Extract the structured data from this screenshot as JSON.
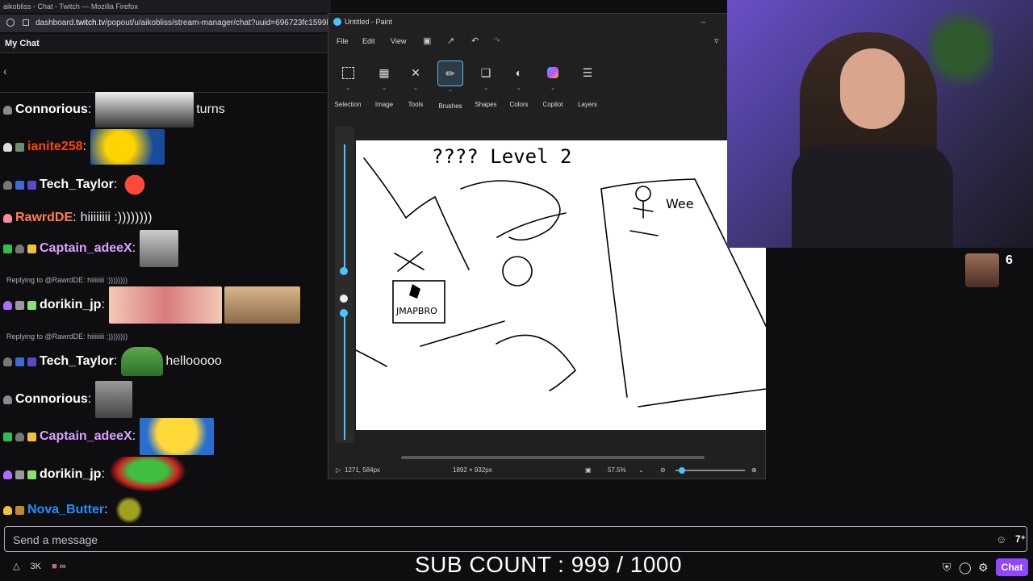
{
  "browser": {
    "title": "aikobliss - Chat - Twitch — Mozilla Firefox",
    "url_prefix": "dashboard.",
    "url_domain": "twitch.tv",
    "url_rest": "/popout/u/aikobliss/stream-manager/chat?uuid=696723fc1599b9429"
  },
  "chat": {
    "header": "My Chat",
    "messages": [
      {
        "user": "Connorious",
        "color": "#ffffff",
        "text": "turns"
      },
      {
        "user": "ianite258",
        "color": "#ff4500",
        "text": ""
      },
      {
        "user": "Tech_Taylor",
        "color": "#ffffff",
        "text": ""
      },
      {
        "user": "RawrdDE",
        "color": "#ff7f50",
        "text": "hiiiiiiii :))))))))"
      },
      {
        "user": "Captain_adeeX",
        "color": "#d9a3ff",
        "text": ""
      },
      {
        "user": "dorikin_jp",
        "color": "#ffffff",
        "text": "",
        "reply": "Replying to @RawrdDE: hiiiiiiii :))))))))"
      },
      {
        "user": "Tech_Taylor",
        "color": "#ffffff",
        "text": "hellooooo",
        "reply": "Replying to @RawrdDE: hiiiiiiii :))))))))"
      },
      {
        "user": "Connorious",
        "color": "#ffffff",
        "text": ""
      },
      {
        "user": "Captain_adeeX",
        "color": "#d9a3ff",
        "text": ""
      },
      {
        "user": "dorikin_jp",
        "color": "#ffffff",
        "text": ""
      },
      {
        "user": "Nova_Butter",
        "color": "#1e90ff",
        "text": ""
      }
    ],
    "input_placeholder": "Send a message",
    "channel_points": "3K",
    "chat_button": "Chat"
  },
  "paint": {
    "title": "Untitled - Paint",
    "menu": [
      "File",
      "Edit",
      "View"
    ],
    "tools": [
      "Selection",
      "Image",
      "Tools",
      "Brushes",
      "Shapes",
      "Colors",
      "Copilot",
      "Layers"
    ],
    "status": {
      "cursor": "1271, 584px",
      "canvas_size": "1892 × 932px",
      "zoom": "57.5%"
    },
    "canvas_doodle_text": [
      "???? Level 2",
      "Wee",
      "JMAPBRO"
    ]
  },
  "stream": {
    "viewer_count": "6",
    "overlay_text": "SUB COUNT : 999 / 1000"
  },
  "colors": {
    "twitch_purple": "#9147ff",
    "background": "#0e0e10",
    "paint_accent": "#4cc2ff"
  }
}
